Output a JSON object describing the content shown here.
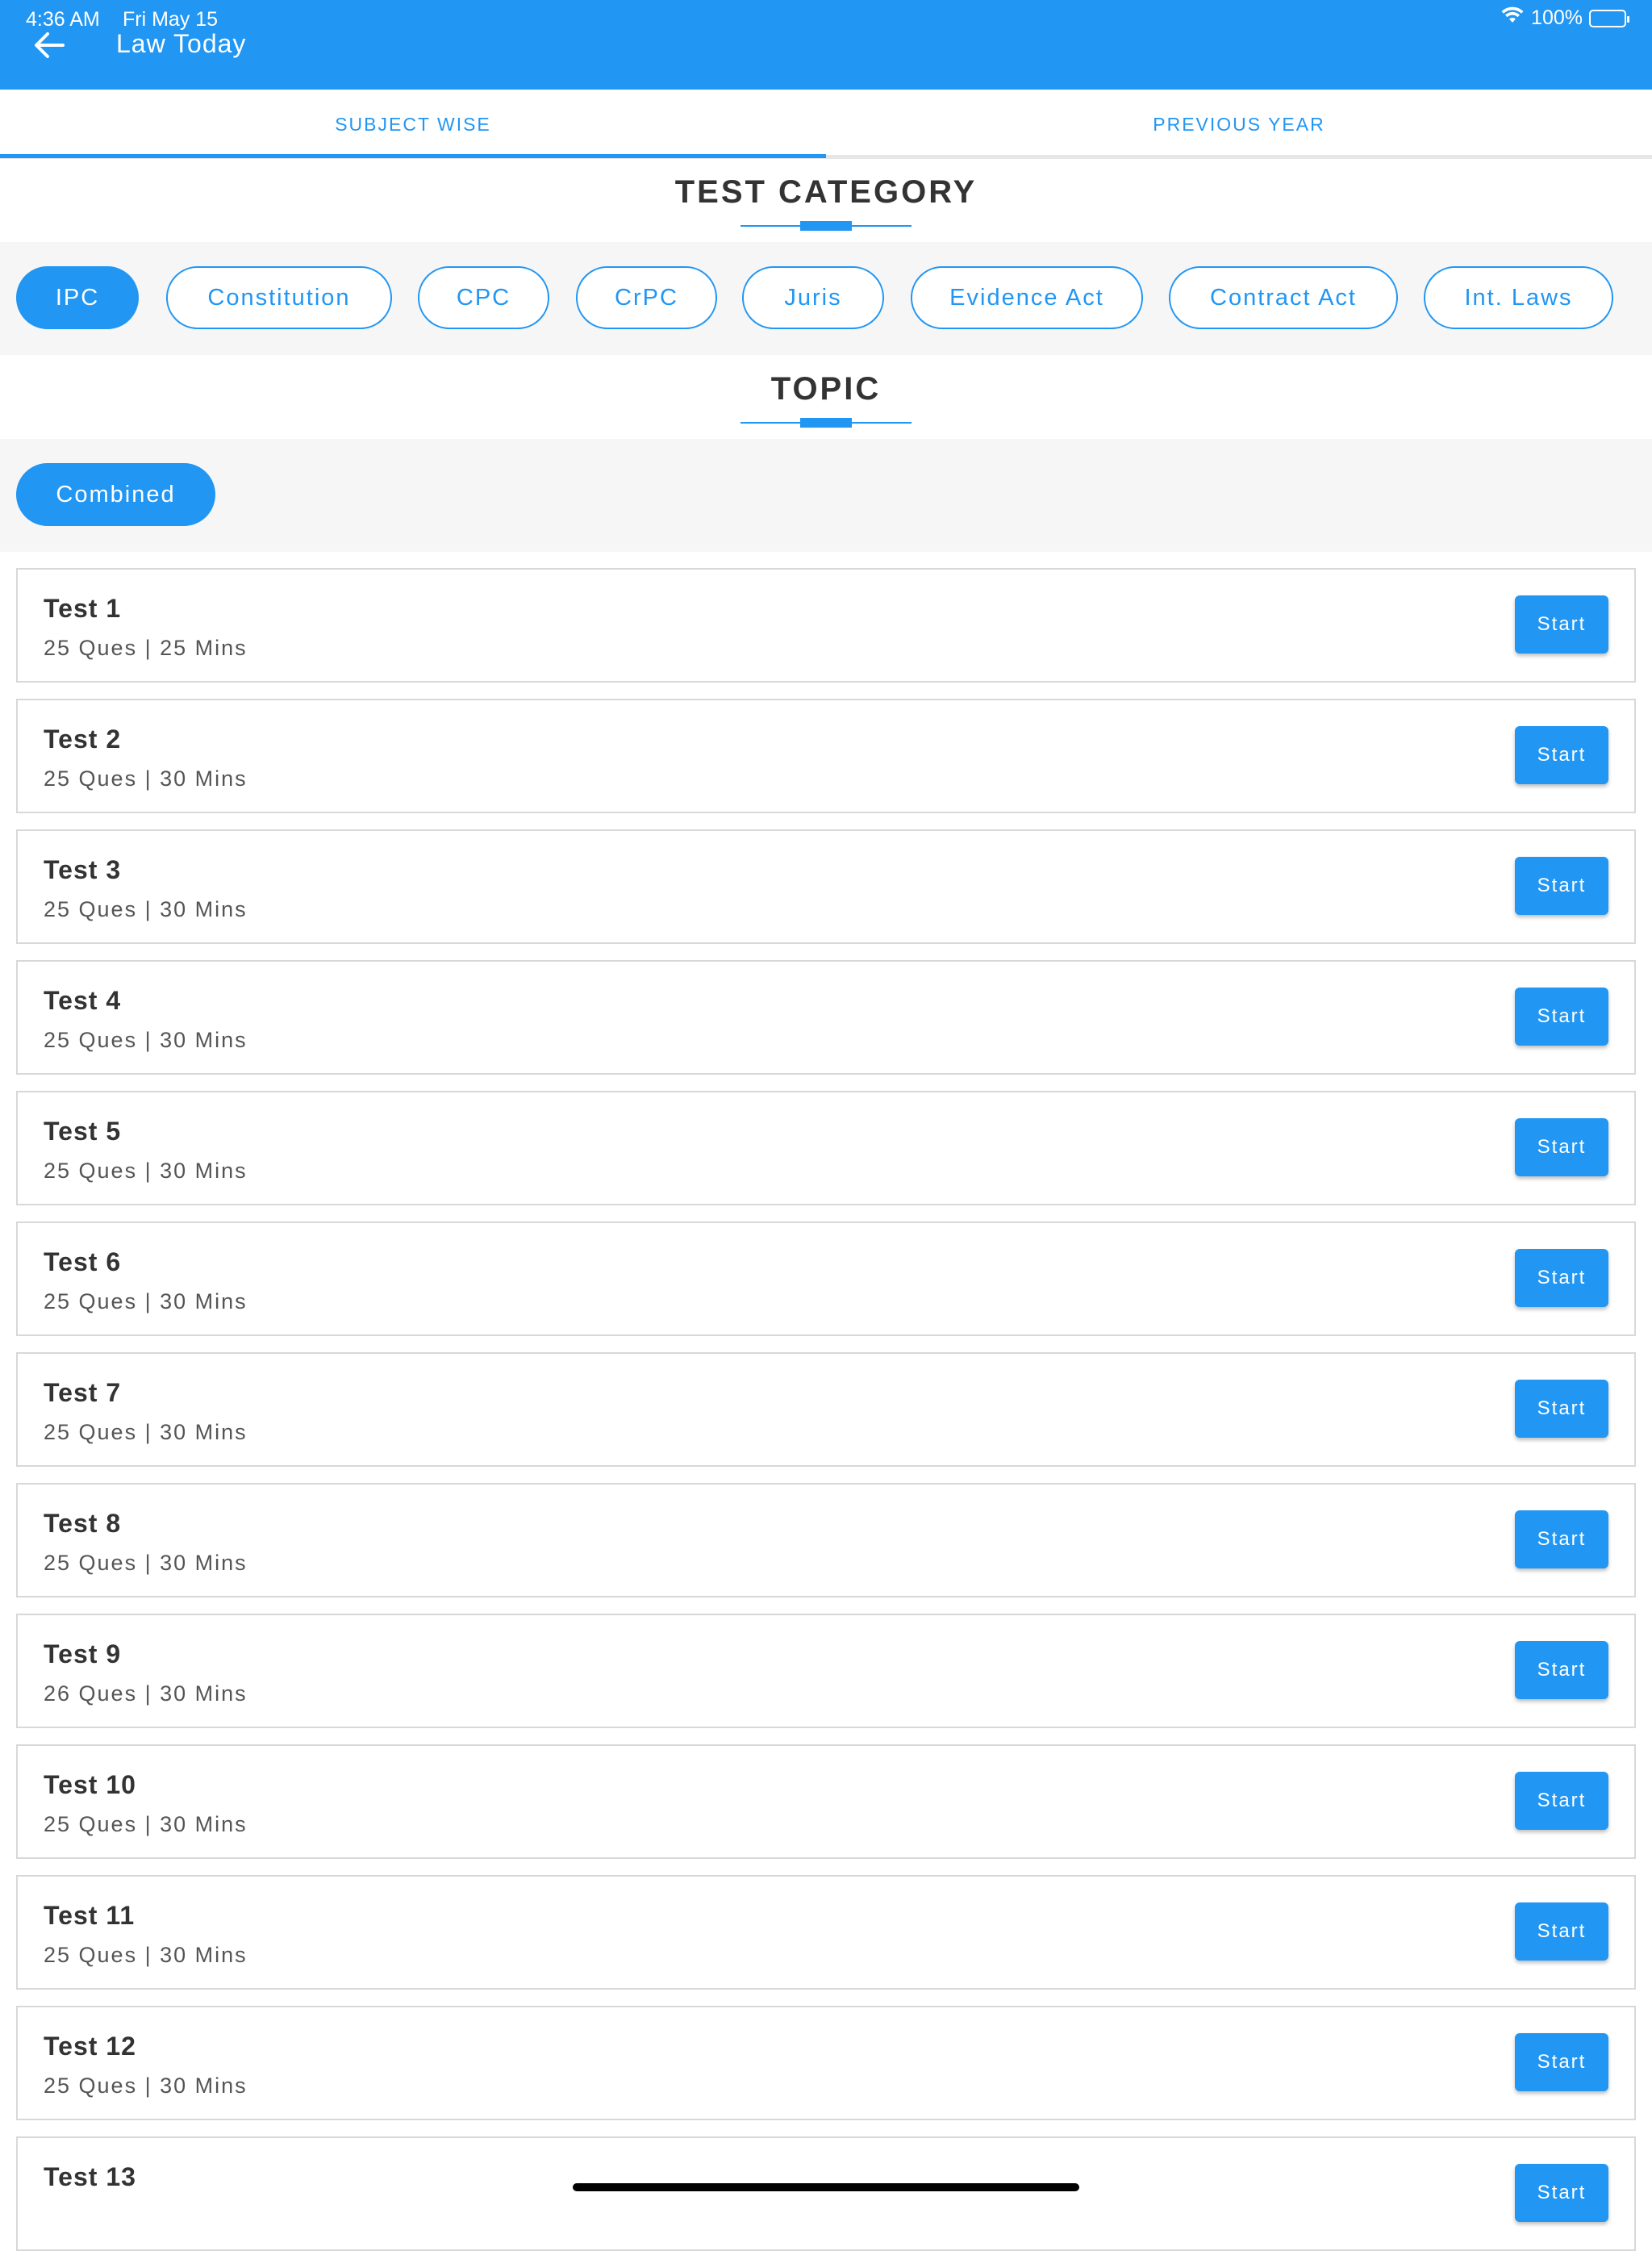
{
  "status_bar": {
    "time": "4:36 AM",
    "date": "Fri May 15",
    "battery": "100%"
  },
  "app_bar": {
    "title": "Law Today"
  },
  "tabs": [
    {
      "label": "SUBJECT WISE"
    },
    {
      "label": "PREVIOUS YEAR"
    }
  ],
  "sections": {
    "category_title": "TEST CATEGORY",
    "topic_title": "TOPIC"
  },
  "categories": [
    {
      "label": "IPC"
    },
    {
      "label": "Constitution"
    },
    {
      "label": "CPC"
    },
    {
      "label": "CrPC"
    },
    {
      "label": "Juris"
    },
    {
      "label": "Evidence Act"
    },
    {
      "label": "Contract Act"
    },
    {
      "label": "Int. Laws"
    }
  ],
  "selected_category": "IPC",
  "topics": [
    {
      "label": "Combined"
    }
  ],
  "selected_topic": "Combined",
  "tests": [
    {
      "title": "Test 1",
      "meta": "25 Ques | 25 Mins",
      "button": "Start"
    },
    {
      "title": "Test 2",
      "meta": "25 Ques | 30 Mins",
      "button": "Start"
    },
    {
      "title": "Test 3",
      "meta": "25 Ques | 30 Mins",
      "button": "Start"
    },
    {
      "title": "Test 4",
      "meta": "25 Ques | 30 Mins",
      "button": "Start"
    },
    {
      "title": "Test 5",
      "meta": "25 Ques | 30 Mins",
      "button": "Start"
    },
    {
      "title": "Test 6",
      "meta": "25 Ques | 30 Mins",
      "button": "Start"
    },
    {
      "title": "Test 7",
      "meta": "25 Ques | 30 Mins",
      "button": "Start"
    },
    {
      "title": "Test 8",
      "meta": "25 Ques | 30 Mins",
      "button": "Start"
    },
    {
      "title": "Test 9",
      "meta": "26 Ques | 30 Mins",
      "button": "Start"
    },
    {
      "title": "Test 10",
      "meta": "25 Ques | 30 Mins",
      "button": "Start"
    },
    {
      "title": "Test 11",
      "meta": "25 Ques | 30 Mins",
      "button": "Start"
    },
    {
      "title": "Test 12",
      "meta": "25 Ques | 30 Mins",
      "button": "Start"
    },
    {
      "title": "Test 13",
      "meta": "",
      "button": "Start"
    }
  ],
  "colors": {
    "primary": "#2196F3",
    "text": "#333333",
    "muted": "#555555",
    "chip_bar_bg": "#f6f6f6"
  }
}
